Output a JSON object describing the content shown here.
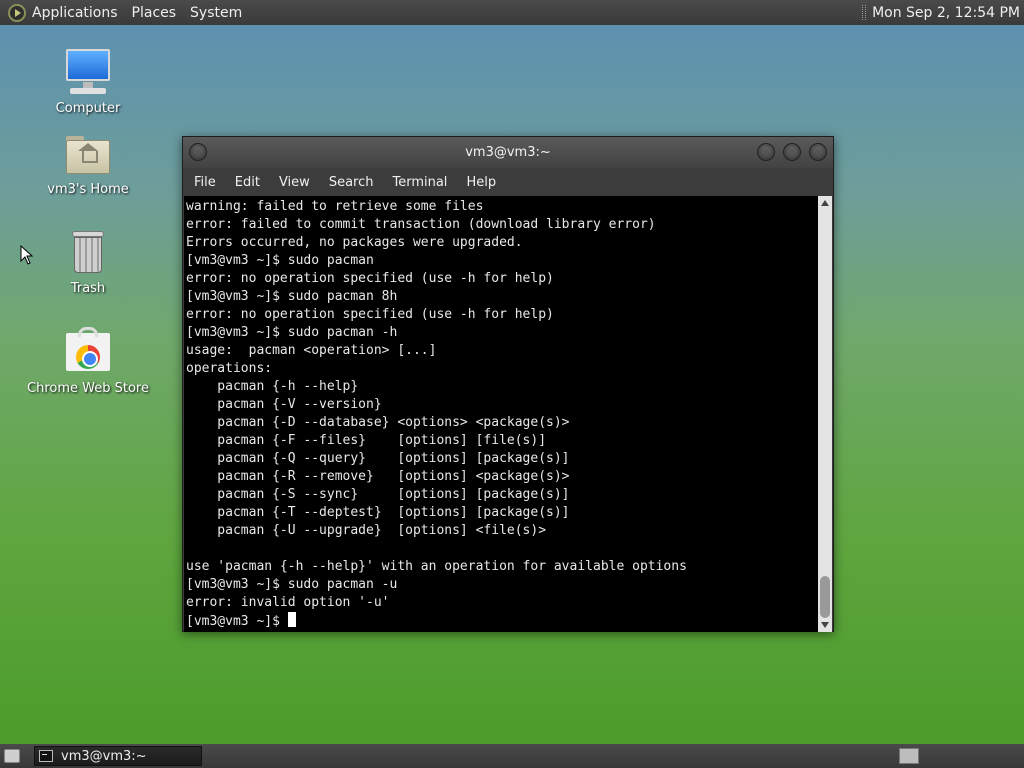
{
  "top_panel": {
    "menus": [
      "Applications",
      "Places",
      "System"
    ],
    "clock": "Mon Sep  2, 12:54 PM"
  },
  "desktop_icons": [
    {
      "label": "Computer",
      "icon": "computer-icon"
    },
    {
      "label": "vm3's Home",
      "icon": "home-folder-icon"
    },
    {
      "label": "Trash",
      "icon": "trash-icon"
    },
    {
      "label": "Chrome Web Store",
      "icon": "chrome-web-store-icon"
    }
  ],
  "window": {
    "title": "vm3@vm3:~",
    "menu": [
      "File",
      "Edit",
      "View",
      "Search",
      "Terminal",
      "Help"
    ]
  },
  "terminal": {
    "lines": [
      "warning: failed to retrieve some files",
      "error: failed to commit transaction (download library error)",
      "Errors occurred, no packages were upgraded.",
      "[vm3@vm3 ~]$ sudo pacman",
      "error: no operation specified (use -h for help)",
      "[vm3@vm3 ~]$ sudo pacman 8h",
      "error: no operation specified (use -h for help)",
      "[vm3@vm3 ~]$ sudo pacman -h",
      "usage:  pacman <operation> [...]",
      "operations:",
      "    pacman {-h --help}",
      "    pacman {-V --version}",
      "    pacman {-D --database} <options> <package(s)>",
      "    pacman {-F --files}    [options] [file(s)]",
      "    pacman {-Q --query}    [options] [package(s)]",
      "    pacman {-R --remove}   [options] <package(s)>",
      "    pacman {-S --sync}     [options] [package(s)]",
      "    pacman {-T --deptest}  [options] [package(s)]",
      "    pacman {-U --upgrade}  [options] <file(s)>",
      "",
      "use 'pacman {-h --help}' with an operation for available options",
      "[vm3@vm3 ~]$ sudo pacman -u",
      "error: invalid option '-u'"
    ],
    "prompt": "[vm3@vm3 ~]$ "
  },
  "taskbar": {
    "task_label": "vm3@vm3:~"
  }
}
